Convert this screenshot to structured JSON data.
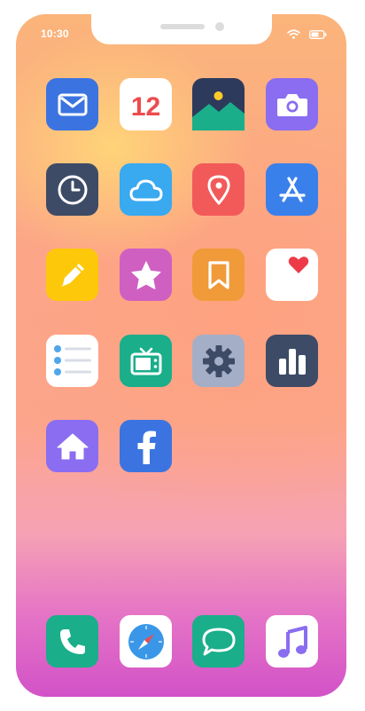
{
  "status_bar": {
    "time": "10:30",
    "wifi_icon": "wifi-icon",
    "battery_icon": "battery-icon"
  },
  "home_screen": {
    "apps": [
      {
        "name": "mail",
        "icon": "envelope-icon",
        "color": "#3b74e0"
      },
      {
        "name": "calendar",
        "icon": "calendar-icon",
        "color": "#ffffff",
        "date": "12",
        "date_color": "#ee4a4d"
      },
      {
        "name": "photos",
        "icon": "image-icon",
        "color": "#2d3a5c"
      },
      {
        "name": "camera",
        "icon": "camera-icon",
        "color": "#8a6df0"
      },
      {
        "name": "clock",
        "icon": "clock-icon",
        "color": "#3d4b66"
      },
      {
        "name": "weather",
        "icon": "cloud-icon",
        "color": "#39a9f0"
      },
      {
        "name": "maps",
        "icon": "location-pin-icon",
        "color": "#f25a5a"
      },
      {
        "name": "app-store",
        "icon": "app-store-icon",
        "color": "#3a80eb"
      },
      {
        "name": "notes",
        "icon": "pencil-icon",
        "color": "#fdc80a"
      },
      {
        "name": "favorites",
        "icon": "star-icon",
        "color": "#d05fc2"
      },
      {
        "name": "books",
        "icon": "bookmark-icon",
        "color": "#f09a3a"
      },
      {
        "name": "health",
        "icon": "heart-icon",
        "color": "#ffffff"
      },
      {
        "name": "reminders",
        "icon": "list-icon",
        "color": "#ffffff"
      },
      {
        "name": "tv",
        "icon": "tv-icon",
        "color": "#1aae8a"
      },
      {
        "name": "settings",
        "icon": "gear-icon",
        "color": "#a4aec6"
      },
      {
        "name": "stats",
        "icon": "bar-chart-icon",
        "color": "#3d4b66"
      },
      {
        "name": "home",
        "icon": "house-icon",
        "color": "#8a6df0"
      },
      {
        "name": "facebook",
        "icon": "facebook-icon",
        "color": "#3b74e0"
      }
    ],
    "dock": [
      {
        "name": "phone",
        "icon": "phone-icon",
        "color": "#1aae8a"
      },
      {
        "name": "safari",
        "icon": "compass-icon",
        "color": "#ffffff"
      },
      {
        "name": "messages",
        "icon": "chat-bubble-icon",
        "color": "#1aae8a"
      },
      {
        "name": "music",
        "icon": "music-note-icon",
        "color": "#ffffff"
      }
    ]
  }
}
